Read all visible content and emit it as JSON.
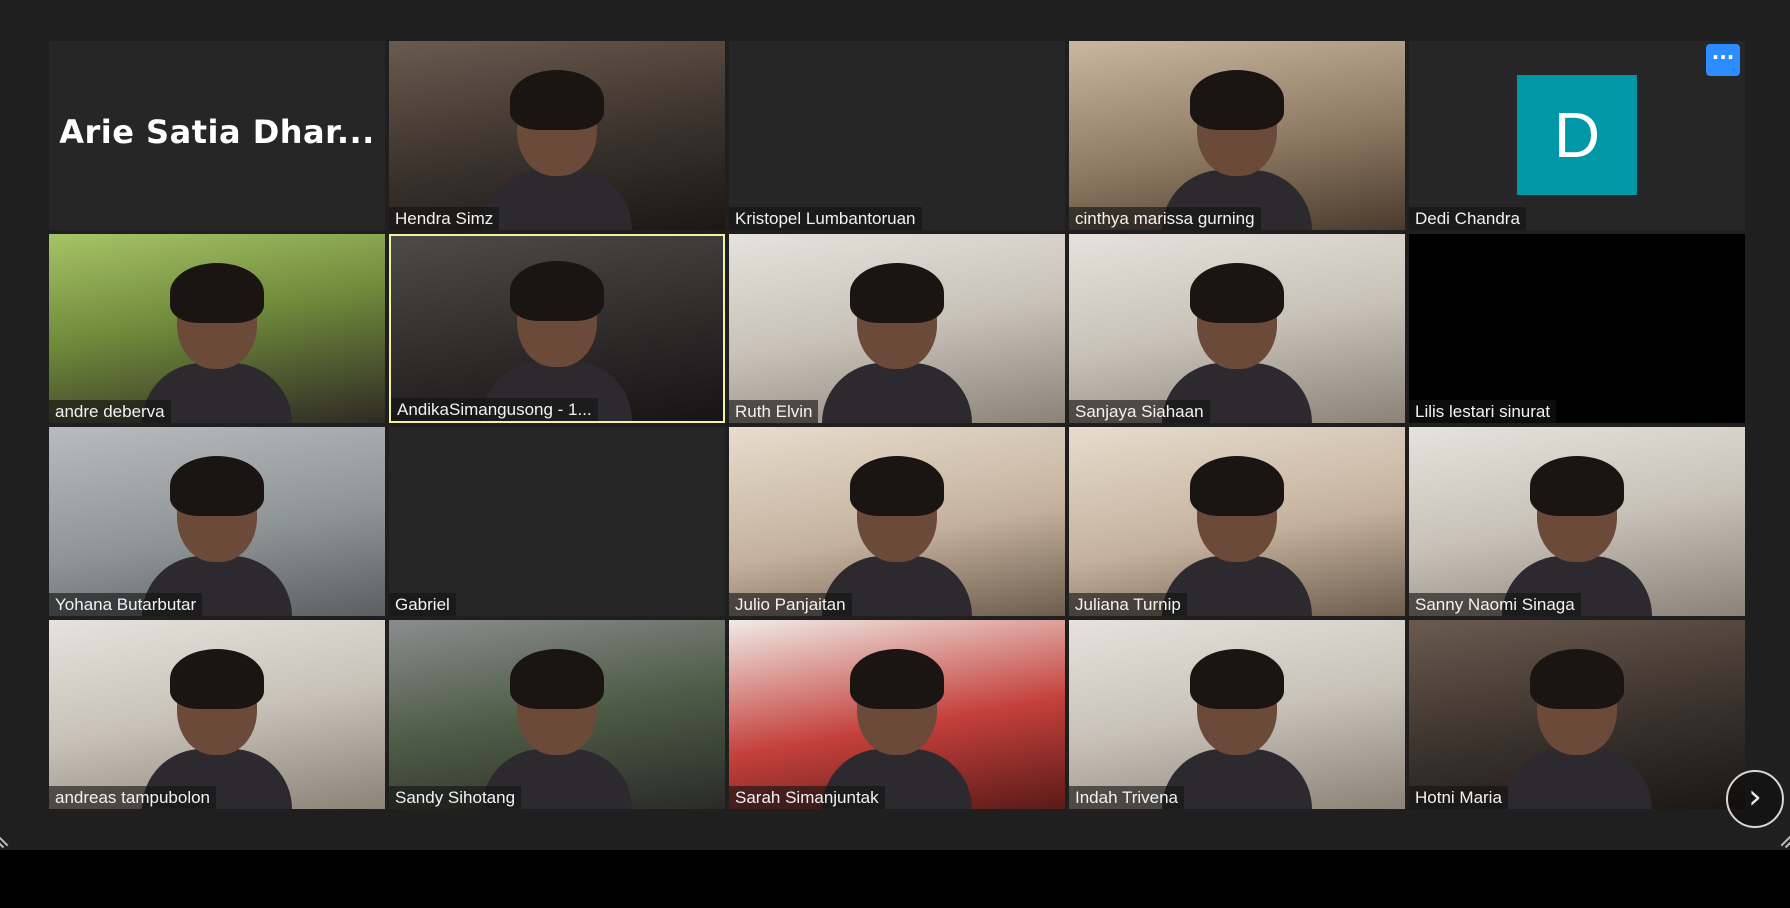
{
  "colors": {
    "stage_background": "#1f1f1f",
    "active_speaker_border": "#f3f29b",
    "avatar_teal": "#0097a7",
    "more_button_blue": "#2d8cff"
  },
  "more_button": {
    "icon": "ellipsis-icon",
    "glyph": "···"
  },
  "next_page": {
    "icon": "chevron-right-icon",
    "glyph": "›"
  },
  "participants": [
    {
      "name": "Arie Satia Dhar...",
      "video": "off",
      "display": "name-only"
    },
    {
      "name": "Hendra Simz",
      "video": "on"
    },
    {
      "name": "Kristopel Lumbantoruan",
      "video": "off"
    },
    {
      "name": "cinthya marissa gurning",
      "video": "on"
    },
    {
      "name": "Dedi Chandra",
      "video": "off",
      "avatar_letter": "D"
    },
    {
      "name": "andre deberva",
      "video": "on"
    },
    {
      "name": "AndikaSimangusong - 1...",
      "video": "on",
      "active_speaker": true
    },
    {
      "name": "Ruth Elvin",
      "video": "on"
    },
    {
      "name": "Sanjaya Siahaan",
      "video": "on"
    },
    {
      "name": "Lilis lestari sinurat",
      "video": "off"
    },
    {
      "name": "Yohana Butarbutar",
      "video": "on"
    },
    {
      "name": "Gabriel",
      "video": "off"
    },
    {
      "name": "Julio Panjaitan",
      "video": "on"
    },
    {
      "name": "Juliana Turnip",
      "video": "on"
    },
    {
      "name": "Sanny Naomi Sinaga",
      "video": "on"
    },
    {
      "name": "andreas tampubolon",
      "video": "on"
    },
    {
      "name": "Sandy Sihotang",
      "video": "on"
    },
    {
      "name": "Sarah Simanjuntak",
      "video": "on"
    },
    {
      "name": "Indah Trivena",
      "video": "on"
    },
    {
      "name": "Hotni Maria",
      "video": "on"
    }
  ]
}
